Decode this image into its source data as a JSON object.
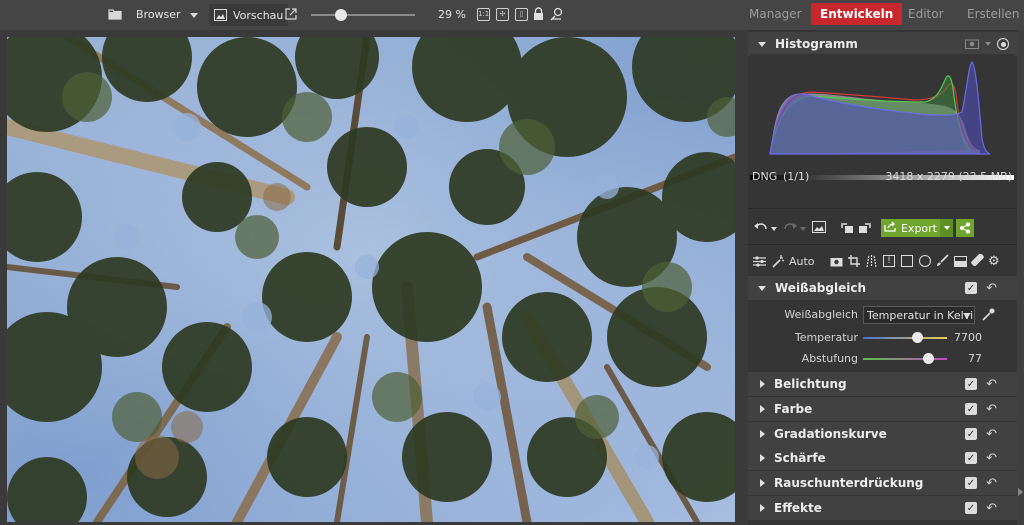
{
  "toolbar": {
    "browser_label": "Browser",
    "preview_label": "Vorschau",
    "zoom_value": "29 %",
    "zoom_fraction": 0.29,
    "icons": [
      "folder-icon",
      "dropdown-arrow-icon",
      "image-icon",
      "external-window-icon",
      "zoom-fit-icon",
      "zoom-fill-icon",
      "zoom-compare-icon",
      "lock-icon",
      "navigator-icon"
    ]
  },
  "modules": {
    "manager": "Manager",
    "develop": "Entwickeln",
    "editor": "Editor",
    "create": "Erstellen",
    "active_color": "#c8272e"
  },
  "histogram": {
    "title": "Histogramm",
    "file_type": "DNG",
    "file_count": "(1/1)",
    "dimensions": "3418 x 2279 (22.5 MB)"
  },
  "actions": {
    "export_label": "Export",
    "accent_color": "#6ea62d"
  },
  "tools": {
    "auto_label": "Auto"
  },
  "white_balance": {
    "title": "Weißabgleich",
    "mode_label": "Weißabgleich",
    "mode_value": "Temperatur in Kelvin",
    "temperature_label": "Temperatur",
    "temperature_value": "7700",
    "temperature_fraction": 0.64,
    "tint_label": "Abstufung",
    "tint_value": "77",
    "tint_fraction": 0.77
  },
  "sections": {
    "exposure": "Belichtung",
    "color": "Farbe",
    "curves": "Gradationskurve",
    "sharpen": "Schärfe",
    "noise": "Rauschunterdrückung",
    "effects": "Effekte"
  }
}
